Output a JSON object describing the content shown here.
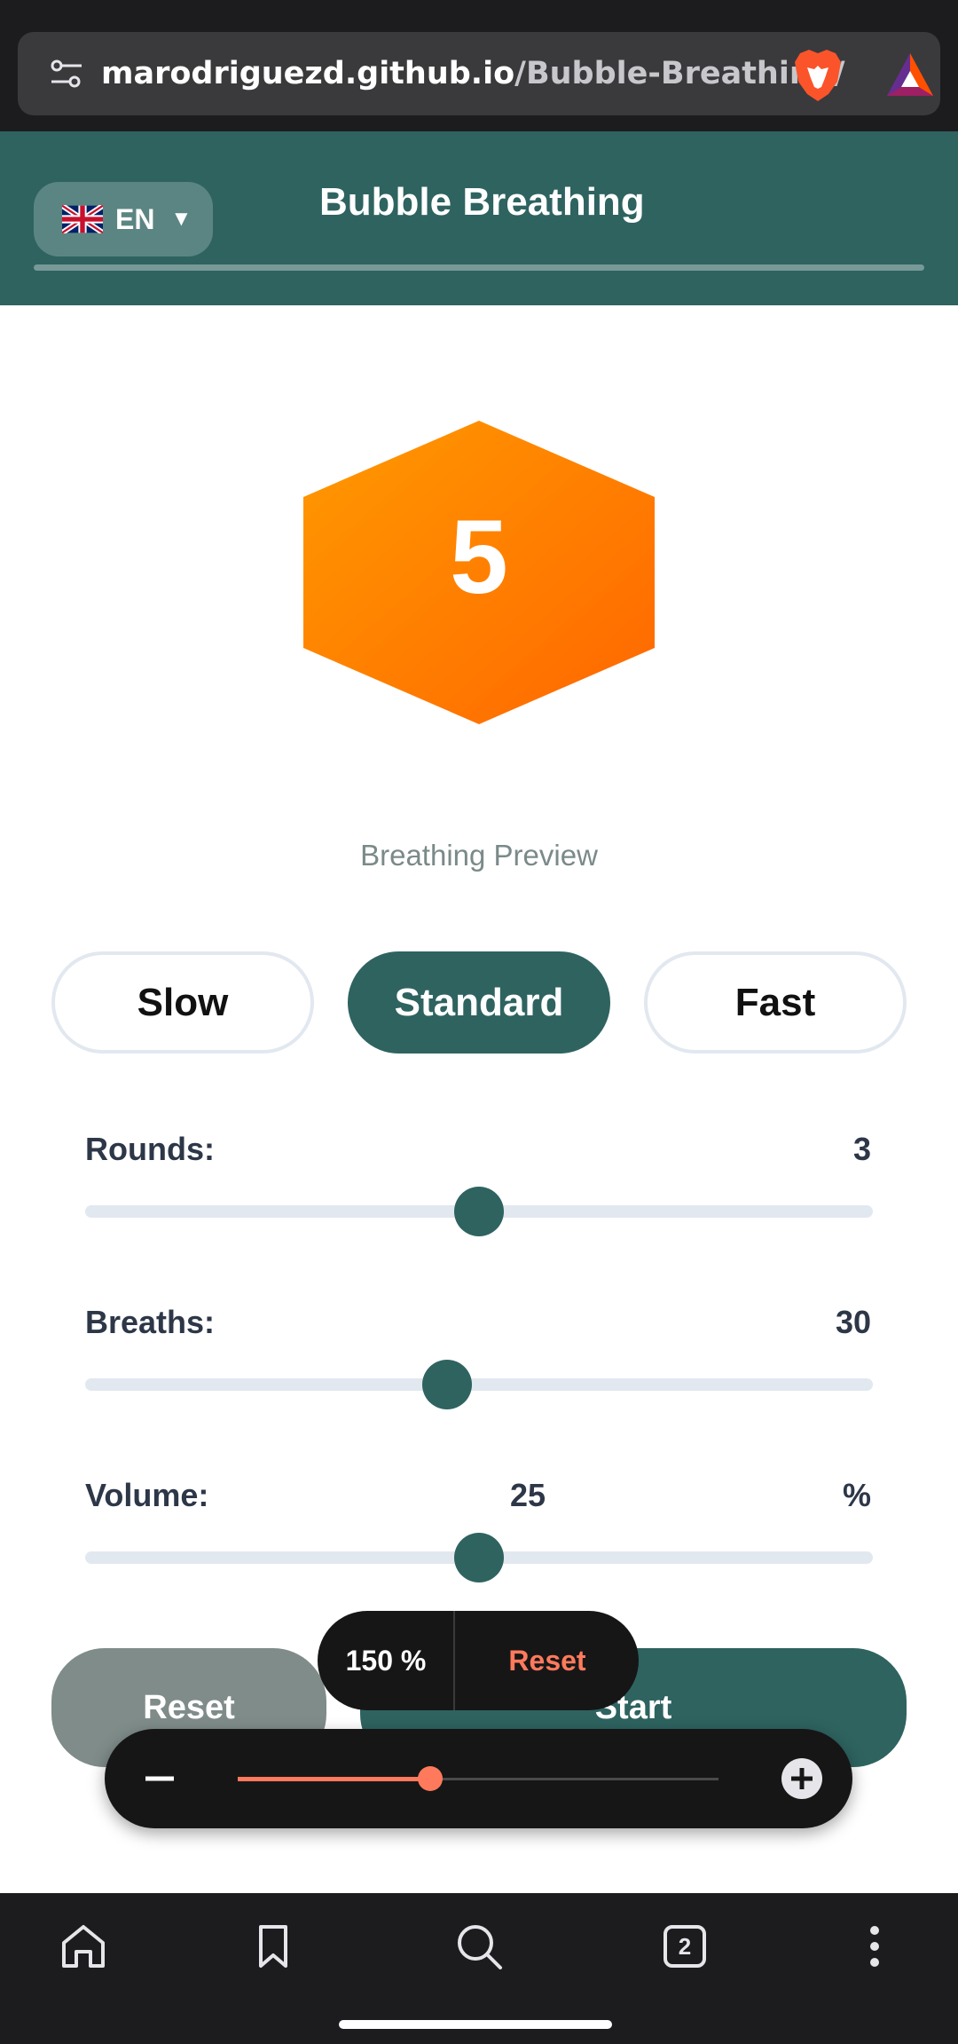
{
  "browser": {
    "url_domain": "marodriguezd.github.io",
    "url_path": "/Bubble-Breathing/",
    "icons": [
      "tune-icon",
      "brave-lion-icon",
      "bat-rewards-icon"
    ]
  },
  "header": {
    "language": "EN",
    "language_flag": "uk-flag-icon",
    "title": "Bubble Breathing"
  },
  "preview": {
    "number": "5",
    "label": "Breathing Preview",
    "hex_color_start": "#ff9a00",
    "hex_color_end": "#ff6a00"
  },
  "speed": {
    "options": [
      {
        "label": "Slow",
        "active": false
      },
      {
        "label": "Standard",
        "active": true
      },
      {
        "label": "Fast",
        "active": false
      }
    ]
  },
  "settings": {
    "rounds": {
      "label": "Rounds:",
      "value": "3",
      "level": 0.5
    },
    "breaths": {
      "label": "Breaths:",
      "value": "30",
      "level": 0.46
    },
    "volume": {
      "label": "Volume:",
      "value": "25",
      "unit": "%",
      "level": 0.5
    }
  },
  "actions": {
    "reset_label": "Reset",
    "start_label": "Start"
  },
  "zoom": {
    "level_text": "150 %",
    "reset_label": "Reset",
    "level": 0.4
  },
  "colors": {
    "primary": "#2e6360",
    "accent": "#ff7a5c",
    "orange": "#ff8000"
  },
  "bottom_nav": [
    "home-icon",
    "bookmark-icon",
    "search-icon",
    "tabs-icon",
    "more-icon"
  ],
  "tabs_count": "2"
}
